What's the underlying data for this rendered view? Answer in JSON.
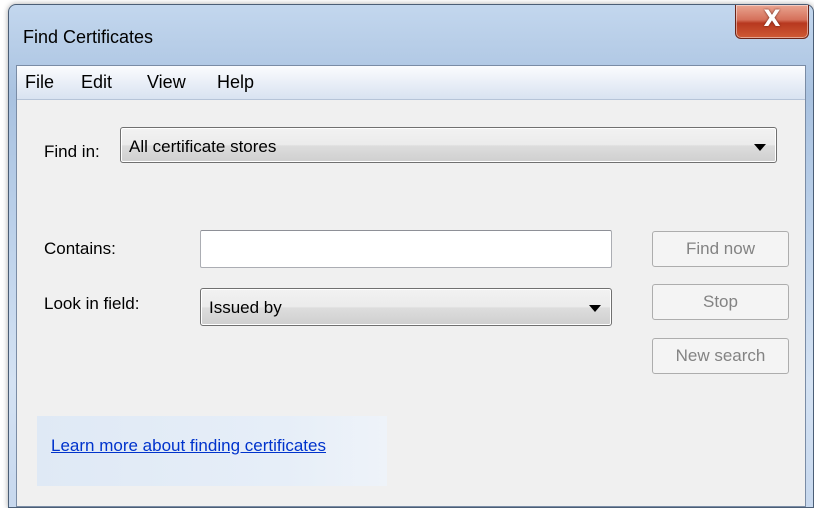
{
  "window": {
    "title": "Find Certificates",
    "close_glyph": "X"
  },
  "menu": {
    "items": [
      "File",
      "Edit",
      "View",
      "Help"
    ]
  },
  "find_in": {
    "label": "Find in:",
    "selected": "All certificate stores"
  },
  "contains": {
    "label": "Contains:",
    "value": ""
  },
  "look_in_field": {
    "label": "Look in field:",
    "selected": "Issued by"
  },
  "buttons": {
    "find_now": "Find now",
    "stop": "Stop",
    "new_search": "New search"
  },
  "help_link": "Learn more about finding certificates",
  "icons": {
    "close": "close-icon",
    "dropdown": "chevron-down-icon"
  },
  "colors": {
    "close_button": "#c9502f",
    "link": "#0033cc",
    "disabled_text": "#838383"
  }
}
